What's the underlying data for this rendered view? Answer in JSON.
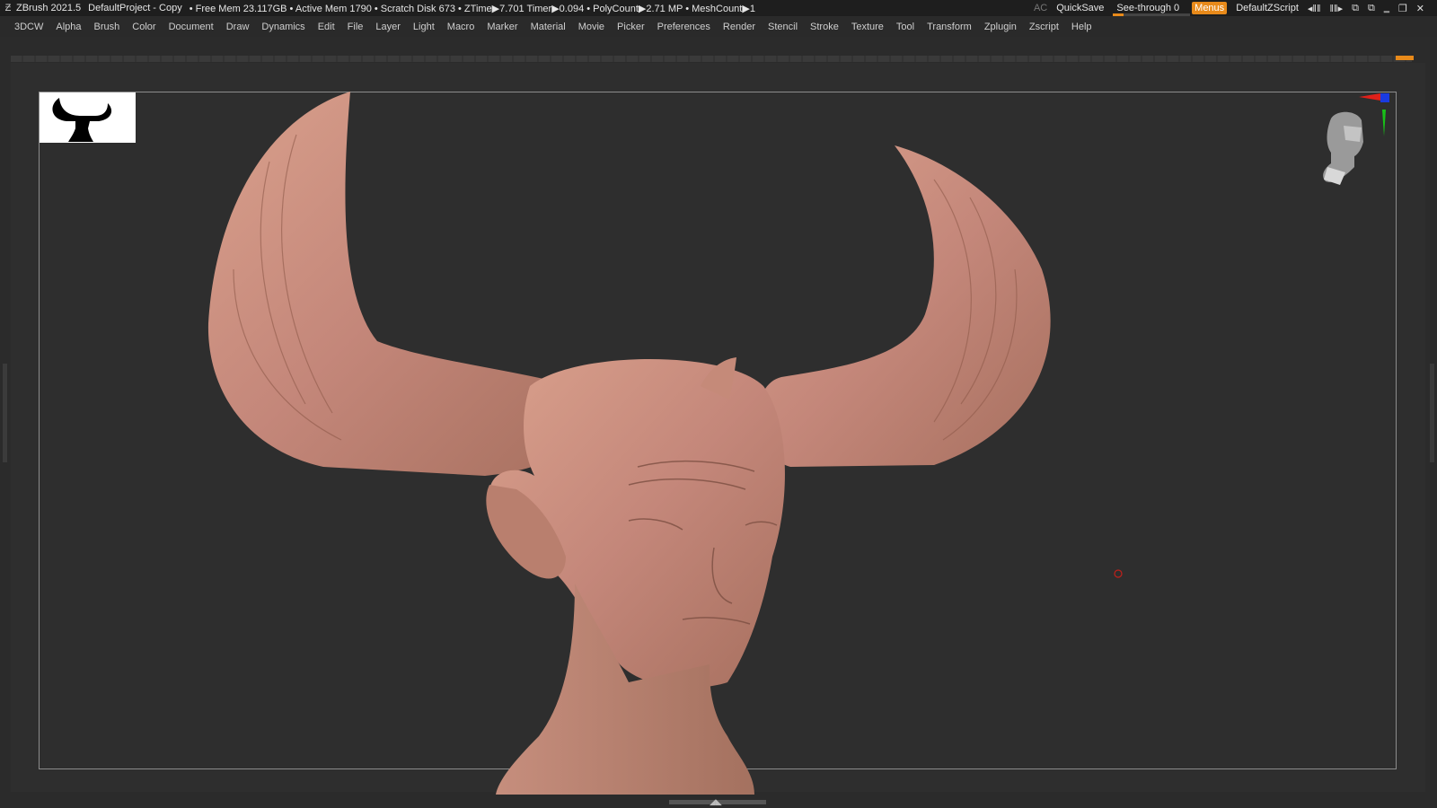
{
  "titlebar": {
    "app": "ZBrush 2021.5",
    "project": "DefaultProject - Copy",
    "stats": "• Free Mem 23.117GB • Active Mem 1790 • Scratch Disk 673 •  ZTime▶7.701 Timer▶0.094 • PolyCount▶2.71 MP  • MeshCount▶1"
  },
  "right_tools": {
    "ac": "AC",
    "quicksave": "QuickSave",
    "see_through_label": "See-through",
    "see_through_value": "0",
    "menus": "Menus",
    "script": "DefaultZScript"
  },
  "menu": [
    "3DCW",
    "Alpha",
    "Brush",
    "Color",
    "Document",
    "Draw",
    "Dynamics",
    "Edit",
    "File",
    "Layer",
    "Light",
    "Macro",
    "Marker",
    "Material",
    "Movie",
    "Picker",
    "Preferences",
    "Render",
    "Stencil",
    "Stroke",
    "Texture",
    "Tool",
    "Transform",
    "Zplugin",
    "Zscript",
    "Help"
  ],
  "colors": {
    "accent": "#e88a1a",
    "background": "#2e2e2e",
    "clay": "#c98e79"
  },
  "icons": {
    "window_controls": [
      "minimize-icon",
      "restore-icon",
      "close-icon"
    ]
  }
}
